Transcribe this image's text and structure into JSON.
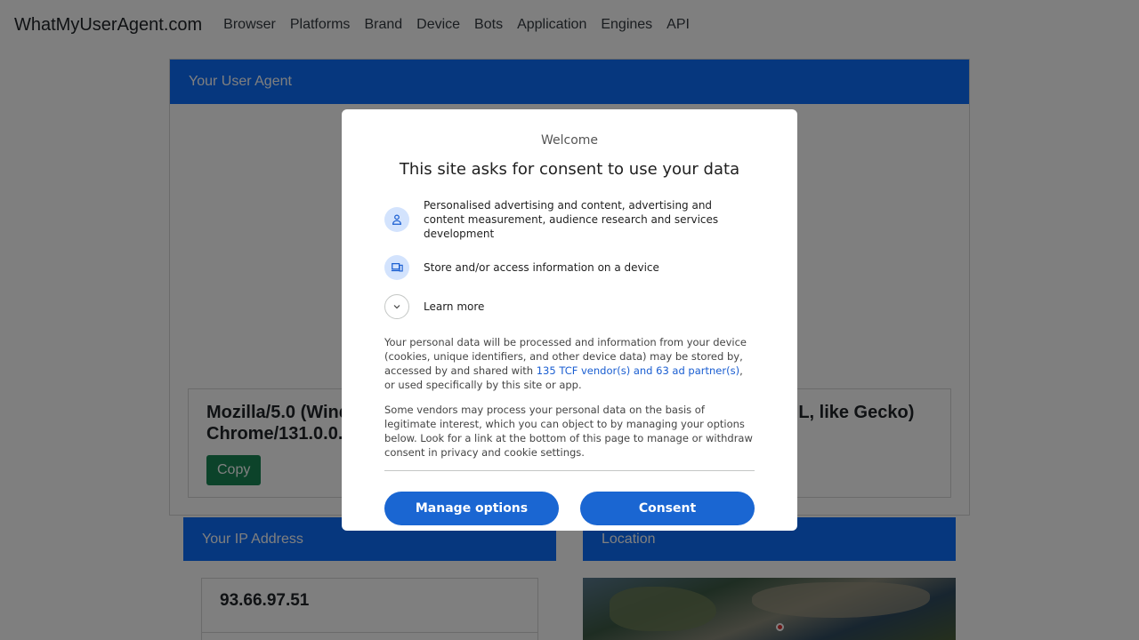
{
  "nav": {
    "brand": "WhatMyUserAgent.com",
    "items": [
      "Browser",
      "Platforms",
      "Brand",
      "Device",
      "Bots",
      "Application",
      "Engines",
      "API"
    ]
  },
  "ua_card": {
    "title": "Your User Agent",
    "ua_line1": "Mozilla/5.0 (Windows NT 10.0; Win64; x64) AppleWebKit/537.36 (KHTML, like Gecko)",
    "ua_line2": "Chrome/131.0.0.0 Safari/537.36",
    "copy_label": "Copy"
  },
  "ip_card": {
    "title": "Your IP Address",
    "ip": "93.66.97.51"
  },
  "location_card": {
    "title": "Location"
  },
  "consent": {
    "welcome": "Welcome",
    "headline": "This site asks for consent to use your data",
    "purpose1": "Personalised advertising and content, advertising and content measurement, audience research and services development",
    "purpose2": "Store and/or access information on a device",
    "learn_more": "Learn more",
    "para1_a": "Your personal data will be processed and information from your device (cookies, unique identifiers, and other device data) may be stored by, accessed by and shared with ",
    "para1_link": "135 TCF vendor(s) and 63 ad partner(s)",
    "para1_b": ", or used specifically by this site or app.",
    "para2": "Some vendors may process your personal data on the basis of legitimate interest, which you can object to by managing your options below. Look for a link at the bottom of this page to manage or withdraw consent in privacy and cookie settings.",
    "manage_label": "Manage options",
    "consent_label": "Consent"
  },
  "colors": {
    "primary": "#0d6efd",
    "success": "#198754",
    "consent_button": "#1a66d2"
  }
}
